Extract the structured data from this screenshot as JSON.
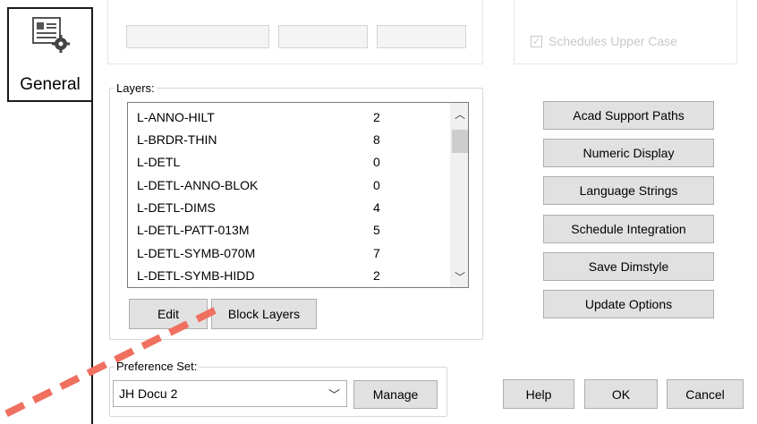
{
  "nav": {
    "general_label": "General"
  },
  "top_faded": {
    "checkbox_label": "Schedules Upper Case"
  },
  "layers": {
    "legend": "Layers:",
    "rows": [
      {
        "name": "L-ANNO-HILT",
        "count": "2"
      },
      {
        "name": "L-BRDR-THIN",
        "count": "8"
      },
      {
        "name": "L-DETL",
        "count": "0"
      },
      {
        "name": "L-DETL-ANNO-BLOK",
        "count": "0"
      },
      {
        "name": "L-DETL-DIMS",
        "count": "4"
      },
      {
        "name": "L-DETL-PATT-013M",
        "count": "5"
      },
      {
        "name": "L-DETL-SYMB-070M",
        "count": "7"
      },
      {
        "name": "L-DETL-SYMB-HIDD",
        "count": "2"
      }
    ],
    "edit_label": "Edit",
    "block_layers_label": "Block Layers"
  },
  "right_buttons": {
    "acad_support_paths": "Acad Support Paths",
    "numeric_display": "Numeric Display",
    "language_strings": "Language Strings",
    "schedule_integration": "Schedule Integration",
    "save_dimstyle": "Save Dimstyle",
    "update_options": "Update Options"
  },
  "preference": {
    "legend": "Preference Set:",
    "selected": "JH Docu 2",
    "manage_label": "Manage"
  },
  "dialog_buttons": {
    "help": "Help",
    "ok": "OK",
    "cancel": "Cancel"
  },
  "colors": {
    "highlight_border": "#1a1a1a",
    "dashed_arrow": "#f07060",
    "button_bg": "#e1e1e1"
  }
}
